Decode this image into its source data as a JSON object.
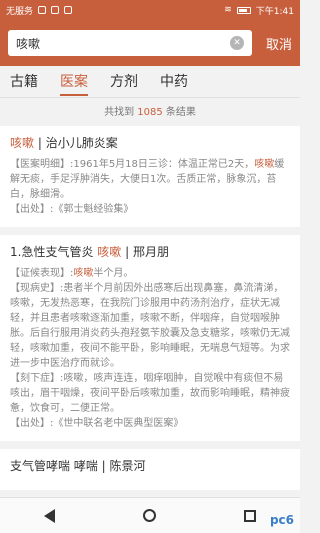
{
  "status": {
    "carrier": "无服务",
    "time": "下午1:41"
  },
  "search": {
    "query": "咳嗽",
    "cancel_label": "取消"
  },
  "tabs": [
    {
      "label": "古籍"
    },
    {
      "label": "医案"
    },
    {
      "label": "方剂"
    },
    {
      "label": "中药"
    }
  ],
  "results": {
    "prefix": "共找到 ",
    "count": "1085",
    "suffix": " 条结果"
  },
  "cards": [
    {
      "title_hl": "咳嗽",
      "title_rest": " | 治小儿肺炎案",
      "lines": [
        {
          "label": "【医案明细】",
          "text_before": ":1961年5月18日三诊：体温正常已2天，",
          "hl": "咳嗽",
          "text_after": "缓解无痰，手足浮肿消失，大便日1次。舌质正常，脉象沉，苔白，脉细滑。"
        },
        {
          "label": "【出处】",
          "text_before": ":《郭士魁经验集》",
          "hl": "",
          "text_after": ""
        }
      ]
    },
    {
      "title_pre": "1.急性支气管炎 ",
      "title_hl": "咳嗽",
      "title_rest": " | 邢月朋",
      "lines": [
        {
          "label": "【证候表现】",
          "text_before": ":",
          "hl": "咳嗽",
          "text_after": "半个月。"
        },
        {
          "label": "【现病史】",
          "text_before": ":患者半个月前因外出感寒后出现鼻塞，鼻流清涕，咳嗽，无发热恶寒，在我院门诊服用中药汤剂治疗，症状无减轻，并且患者咳嗽逐渐加重，咳嗽不断，伴咽痒，自觉咽喉肿胀。后自行服用消炎药头孢羟氨苄胶囊及急支糖浆，咳嗽仍无减轻，咳嗽加重，夜间不能平卧，影响睡眠，无喘息气短等。为求进一步中医治疗而就诊。",
          "hl": "",
          "text_after": ""
        },
        {
          "label": "【刻下症】",
          "text_before": ":咳嗽，咳声连连，咽痒咽肿，自觉喉中有痰但不易咳出，眉干咽燥，夜间平卧后咳嗽加重，故而影响睡眠，精神疲惫，饮食可，二便正常。",
          "hl": "",
          "text_after": ""
        },
        {
          "label": "【出处】",
          "text_before": ":《世中联名老中医典型医案》",
          "hl": "",
          "text_after": ""
        }
      ]
    },
    {
      "title_hl": "",
      "title_rest": "支气管哮喘 哮喘 | 陈景河",
      "lines": []
    }
  ],
  "watermark": "pc6"
}
